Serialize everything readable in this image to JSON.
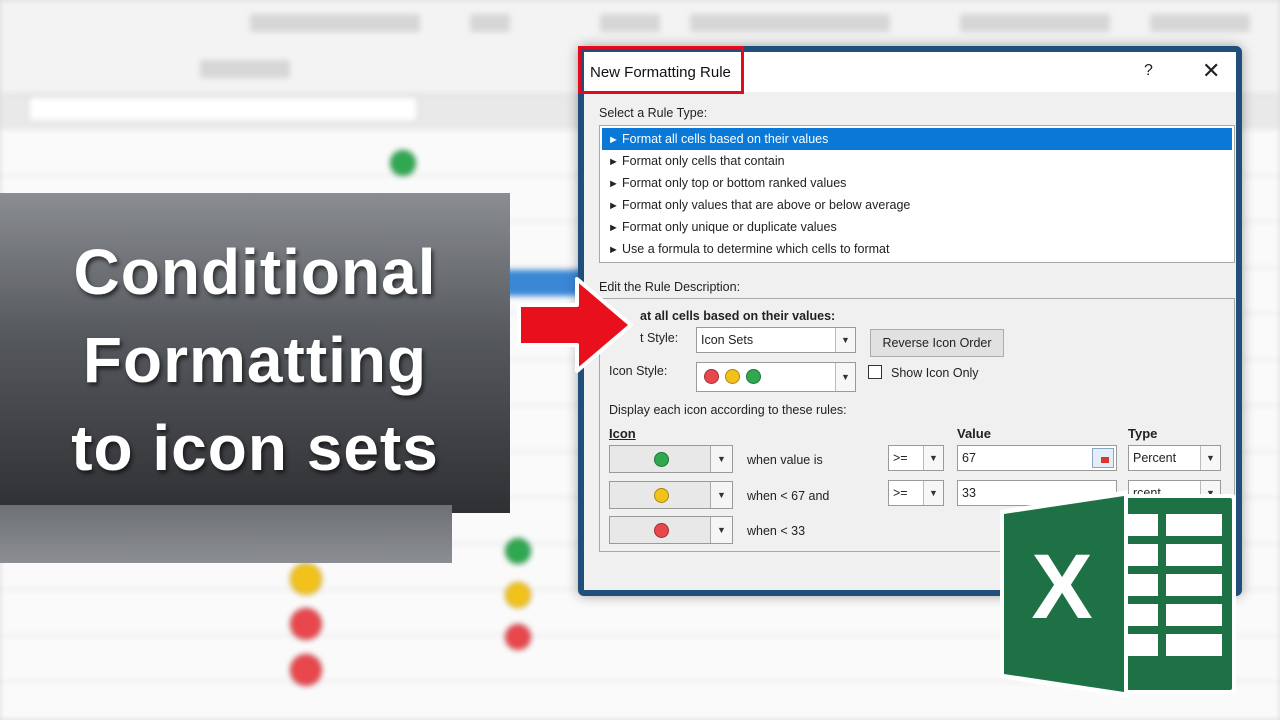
{
  "thumbnail": {
    "title_lines": [
      "Conditional",
      "Formatting",
      "to icon sets"
    ]
  },
  "dialog": {
    "title": "New Formatting Rule",
    "help_label": "?",
    "close_label": "✕",
    "rule_type_label": "Select a Rule Type:",
    "rule_types": [
      "Format all cells based on their values",
      "Format only cells that contain",
      "Format only top or bottom ranked values",
      "Format only values that are above or below average",
      "Format only unique or duplicate values",
      "Use a formula to determine which cells to format"
    ],
    "selected_rule_index": 0,
    "rule_description_label": "Edit the Rule Description:",
    "description_heading": "at all cells based on their values:",
    "format_style_label": "t Style:",
    "format_style_value": "Icon Sets",
    "reverse_icon_order_label": "Reverse Icon Order",
    "icon_style_label": "Icon Style:",
    "show_icon_only_label": "Show Icon Only",
    "display_rules_label": "Display each icon according to these rules:",
    "col_icon": "Icon",
    "col_value": "Value",
    "col_type": "Type",
    "rules": [
      {
        "icon": "green-circle",
        "condition": "when value is",
        "operator": ">=",
        "value": "67",
        "type": "Percent"
      },
      {
        "icon": "yellow-circle",
        "condition": "when < 67 and",
        "operator": ">=",
        "value": "33",
        "type": "rcent"
      },
      {
        "icon": "red-circle",
        "condition": "when < 33"
      }
    ]
  },
  "colors": {
    "green": "#2fa84f",
    "yellow": "#f2c21b",
    "red": "#e8474c",
    "selection": "#0a78d7",
    "highlight_box": "#e00c1d",
    "excel_green": "#1e7145"
  }
}
